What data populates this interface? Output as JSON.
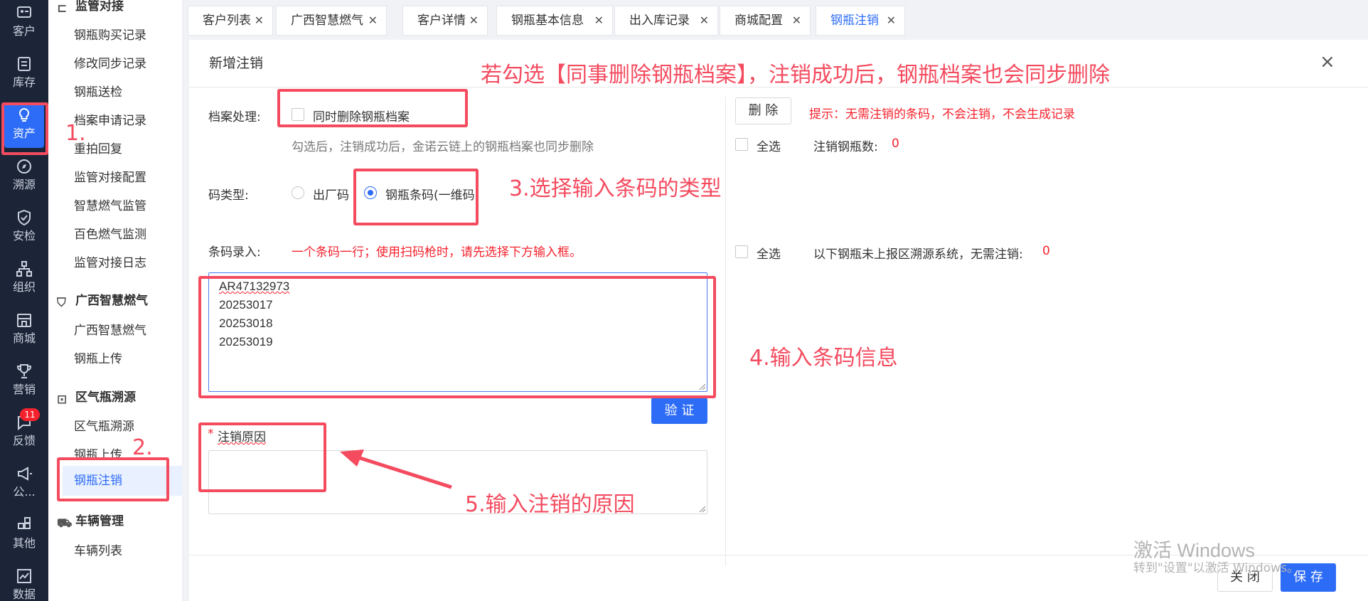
{
  "rail": {
    "items": [
      {
        "label": "客户",
        "icon": "customer-card-icon"
      },
      {
        "label": "库存",
        "icon": "inventory-list-icon"
      },
      {
        "label": "资产",
        "icon": "lightbulb-icon"
      },
      {
        "label": "溯源",
        "icon": "compass-icon"
      },
      {
        "label": "安检",
        "icon": "shield-check-icon"
      },
      {
        "label": "组织",
        "icon": "org-chart-icon"
      },
      {
        "label": "商城",
        "icon": "store-icon"
      },
      {
        "label": "营销",
        "icon": "trophy-icon"
      },
      {
        "label": "反馈",
        "icon": "feedback-icon",
        "badge": "11"
      },
      {
        "label": "公...",
        "icon": "megaphone-icon"
      },
      {
        "label": "其他",
        "icon": "grid-icon"
      },
      {
        "label": "数据",
        "icon": "chart-icon"
      }
    ]
  },
  "menu": {
    "top_group": "监管对接",
    "items_group1": [
      "钢瓶购买记录",
      "修改同步记录",
      "钢瓶送检",
      "档案申请记录",
      "重拍回复",
      "监管对接配置",
      "智慧燃气监管",
      "百色燃气监测",
      "监管对接日志"
    ],
    "group2": "广西智慧燃气",
    "items_group2": [
      "广西智慧燃气",
      "钢瓶上传"
    ],
    "group3": "区气瓶溯源",
    "items_group3": [
      "区气瓶溯源",
      "钢瓶上传",
      "钢瓶注销"
    ],
    "group4": "车辆管理",
    "items_group4": [
      "车辆列表"
    ]
  },
  "tabs": [
    "客户列表",
    "广西智慧燃气",
    "客户详情",
    "钢瓶基本信息",
    "出入库记录",
    "商城配置",
    "钢瓶注销"
  ],
  "dialog": {
    "title": "新增注销",
    "close": "×",
    "archive_label": "档案处理:",
    "archive_checkbox": "同时删除钢瓶档案",
    "archive_hint": "勾选后，注销成功后，金诺云链上的钢瓶档案也同步删除",
    "code_type_label": "码类型:",
    "code_type_options": [
      "出厂码",
      "钢瓶条码(一维码)"
    ],
    "code_type_selected": "钢瓶条码(一维码)",
    "barcode_label": "条码录入:",
    "barcode_hint": "一个条码一行；使用扫码枪时，请先选择下方输入框。",
    "barcodes": [
      "AR47132973",
      "20253017",
      "20253018",
      "20253019"
    ],
    "verify_button": "验 证",
    "reason_required_mark": "*",
    "reason_label": "注销原因",
    "delete_button": "删 除",
    "delete_tip": "提示：无需注销的条码，不会注销，不会生成记录",
    "select_all_1": "全选",
    "cancel_count_label": "注销钢瓶数:",
    "cancel_count": "0",
    "select_all_2": "全选",
    "unreported_label": "以下钢瓶未上报区溯源系统，无需注销:",
    "unreported_count": "0",
    "close_button": "关 闭",
    "save_button": "保 存"
  },
  "annotations": {
    "step1": "1.",
    "step2": "2.",
    "top_note": "若勾选【同事删除钢瓶档案】，注销成功后，钢瓶档案也会同步删除",
    "step3": "3.选择输入条码的类型",
    "step4": "4.输入条码信息",
    "step5": "5.输入注销的原因",
    "color": "#f44b5f"
  },
  "watermark": {
    "line1": "激活 Windows",
    "line2": "转到\"设置\"以激活 Windows。"
  }
}
